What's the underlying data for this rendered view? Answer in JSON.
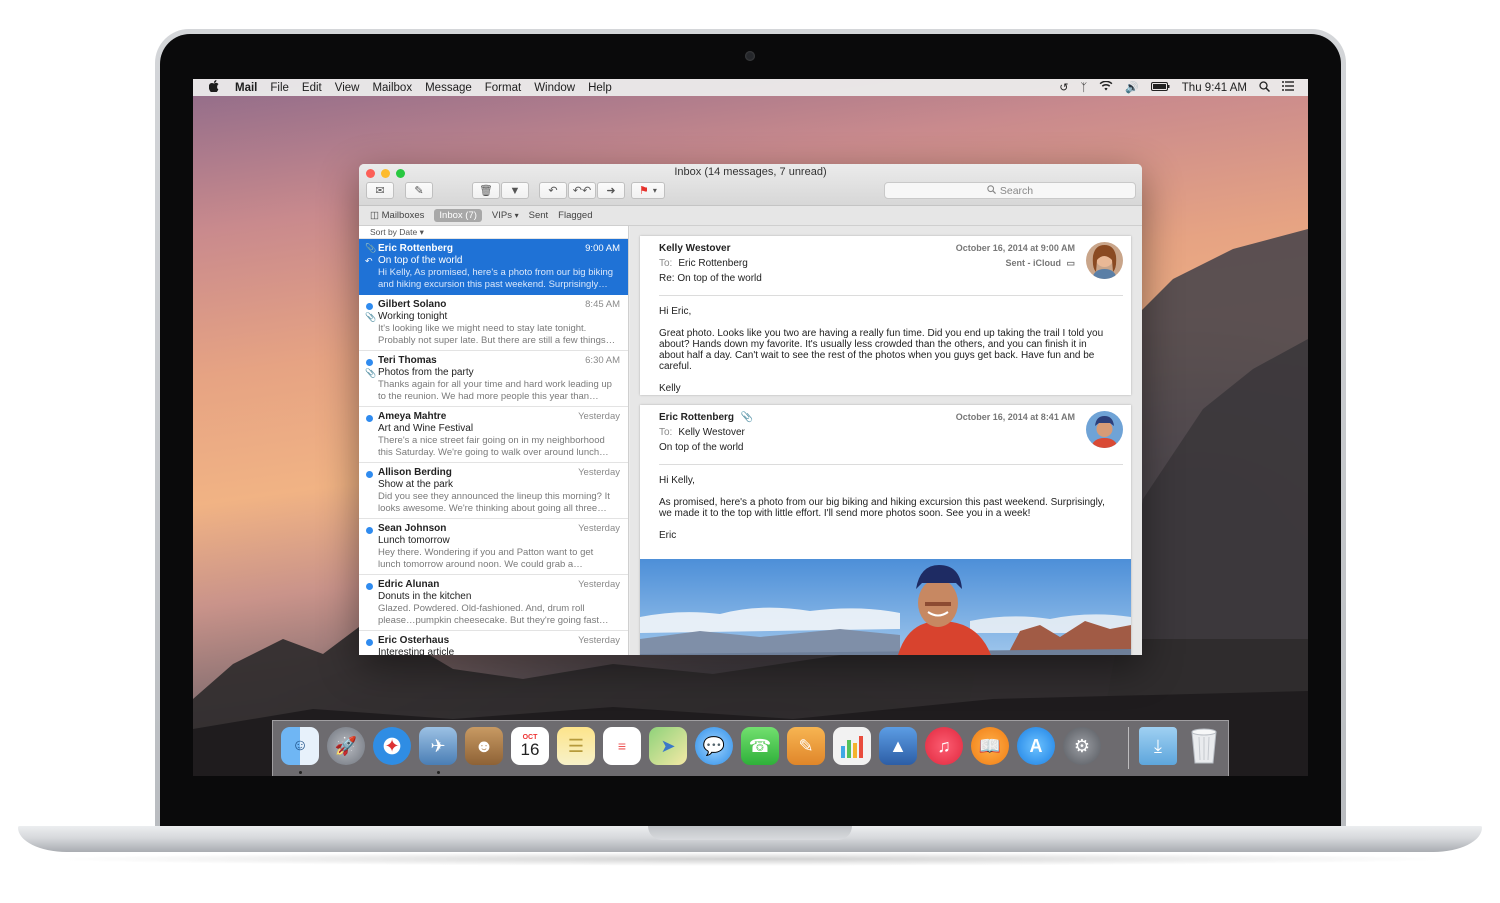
{
  "menubar": {
    "apple": "",
    "items": [
      "Mail",
      "File",
      "Edit",
      "View",
      "Mailbox",
      "Message",
      "Format",
      "Window",
      "Help"
    ],
    "clock": "Thu 9:41 AM",
    "status_icons": [
      "time-machine-icon",
      "bluetooth-icon",
      "wifi-icon",
      "volume-icon",
      "battery-icon",
      "spotlight-icon",
      "notification-center-icon"
    ]
  },
  "window": {
    "title": "Inbox (14 messages, 7 unread)",
    "search_placeholder": "Search",
    "favorites": {
      "mailboxes": "Mailboxes",
      "inbox": "Inbox (7)",
      "vips": "VIPs",
      "sent": "Sent",
      "flagged": "Flagged"
    },
    "sort": "Sort by Date"
  },
  "messages": [
    {
      "from": "Eric Rottenberg",
      "time": "9:00 AM",
      "subject": "On top of the world",
      "preview1": "Hi Kelly, As promised, here's a photo from our big biking",
      "preview2": "and hiking excursion this past weekend. Surprisingly…"
    },
    {
      "from": "Gilbert Solano",
      "time": "8:45 AM",
      "subject": "Working tonight",
      "preview1": "It's looking like we might need to stay late tonight.",
      "preview2": "Probably not super late. But there are still a few things…"
    },
    {
      "from": "Teri Thomas",
      "time": "6:30 AM",
      "subject": "Photos from the party",
      "preview1": "Thanks again for all your time and hard work leading up",
      "preview2": "to the reunion. We had more people this year than…"
    },
    {
      "from": "Ameya Mahtre",
      "time": "Yesterday",
      "subject": "Art and Wine Festival",
      "preview1": "There's a nice street fair going on in my neighborhood",
      "preview2": "this Saturday. We're going to walk over around lunch…"
    },
    {
      "from": "Allison Berding",
      "time": "Yesterday",
      "subject": "Show at the park",
      "preview1": "Did you see they announced the lineup this morning? It",
      "preview2": "looks awesome. We're thinking about going all three…"
    },
    {
      "from": "Sean Johnson",
      "time": "Yesterday",
      "subject": "Lunch tomorrow",
      "preview1": "Hey there. Wondering if you and Patton want to get",
      "preview2": "lunch tomorrow around noon. We could grab a…"
    },
    {
      "from": "Edric Alunan",
      "time": "Yesterday",
      "subject": "Donuts in the kitchen",
      "preview1": "Glazed. Powdered. Old-fashioned. And, drum roll",
      "preview2": "please…pumpkin cheesecake. But they're going fast…"
    },
    {
      "from": "Eric Osterhaus",
      "time": "Yesterday",
      "subject": "Interesting article",
      "preview1": "",
      "preview2": ""
    }
  ],
  "thread": [
    {
      "from": "Kelly Westover",
      "to_label": "To:",
      "to": "Eric Rottenberg",
      "subject": "Re: On top of the world",
      "date": "October 16, 2014 at 9:00 AM",
      "sent": "Sent - iCloud",
      "greeting": "Hi Eric,",
      "body": "Great photo. Looks like you two are having a really fun time. Did you end up taking the trail I told you about? Hands down my favorite. It's usually less crowded than the others, and you can finish it in about half a day. Can't wait to see the rest of the photos when you guys get back. Have fun and be careful.",
      "signature": "Kelly"
    },
    {
      "from": "Eric Rottenberg",
      "to_label": "To:",
      "to": "Kelly Westover",
      "subject": "On top of the world",
      "date": "October 16, 2014 at 8:41 AM",
      "greeting": "Hi Kelly,",
      "body": "As promised, here's a photo from our big biking and hiking excursion this past weekend. Surprisingly, we made it to the top with little effort. I'll send more photos soon. See you in a week!",
      "signature": "Eric"
    }
  ],
  "dock": {
    "calendar_month": "OCT",
    "calendar_day": "16",
    "apps": [
      "finder-icon",
      "launchpad-icon",
      "safari-icon",
      "mail-icon",
      "contacts-icon",
      "calendar-icon",
      "notes-icon",
      "reminders-icon",
      "maps-icon",
      "messages-icon",
      "facetime-icon",
      "pages-icon",
      "numbers-icon",
      "keynote-icon",
      "itunes-icon",
      "ibooks-icon",
      "app-store-icon",
      "system-preferences-icon",
      "downloads-icon",
      "trash-icon"
    ]
  }
}
